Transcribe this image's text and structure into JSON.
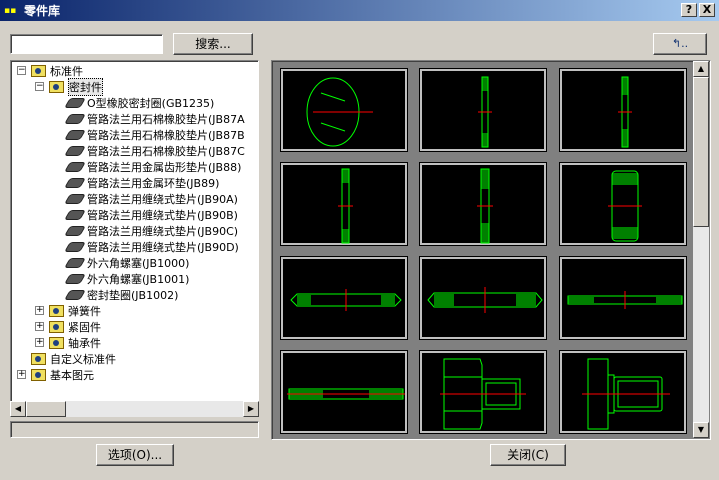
{
  "window": {
    "title": "零件库",
    "help": "?",
    "close": "X"
  },
  "search": {
    "value": "",
    "button": "搜索..."
  },
  "tree": [
    {
      "label": "标准件",
      "level": 0,
      "kind": "folder",
      "exp": "−"
    },
    {
      "label": "密封件",
      "level": 1,
      "kind": "folder-open",
      "exp": "−",
      "selected": true
    },
    {
      "label": "O型橡胶密封圈(GB1235)",
      "level": 2,
      "kind": "part"
    },
    {
      "label": "管路法兰用石棉橡胶垫片(JB87A",
      "level": 2,
      "kind": "part"
    },
    {
      "label": "管路法兰用石棉橡胶垫片(JB87B",
      "level": 2,
      "kind": "part"
    },
    {
      "label": "管路法兰用石棉橡胶垫片(JB87C",
      "level": 2,
      "kind": "part"
    },
    {
      "label": "管路法兰用金属齿形垫片(JB88)",
      "level": 2,
      "kind": "part"
    },
    {
      "label": "管路法兰用金属环垫(JB89)",
      "level": 2,
      "kind": "part"
    },
    {
      "label": "管路法兰用缠绕式垫片(JB90A)",
      "level": 2,
      "kind": "part"
    },
    {
      "label": "管路法兰用缠绕式垫片(JB90B)",
      "level": 2,
      "kind": "part"
    },
    {
      "label": "管路法兰用缠绕式垫片(JB90C)",
      "level": 2,
      "kind": "part"
    },
    {
      "label": "管路法兰用缠绕式垫片(JB90D)",
      "level": 2,
      "kind": "part"
    },
    {
      "label": "外六角螺塞(JB1000)",
      "level": 2,
      "kind": "part"
    },
    {
      "label": "外六角螺塞(JB1001)",
      "level": 2,
      "kind": "part"
    },
    {
      "label": "密封垫圈(JB1002)",
      "level": 2,
      "kind": "part"
    },
    {
      "label": "弹簧件",
      "level": 1,
      "kind": "folder",
      "exp": "+"
    },
    {
      "label": "紧固件",
      "level": 1,
      "kind": "folder",
      "exp": "+"
    },
    {
      "label": "轴承件",
      "level": 1,
      "kind": "folder",
      "exp": "+"
    },
    {
      "label": "自定义标准件",
      "level": 0,
      "kind": "folder"
    },
    {
      "label": "基本图元",
      "level": 0,
      "kind": "folder",
      "exp": "+"
    }
  ],
  "buttons": {
    "options": "选项(O)...",
    "close": "关闭(C)",
    "up": "↰.."
  },
  "colors": {
    "thumb_line": "#00ff00",
    "thumb_center": "#ff0000",
    "thumb_bg": "#000000"
  }
}
